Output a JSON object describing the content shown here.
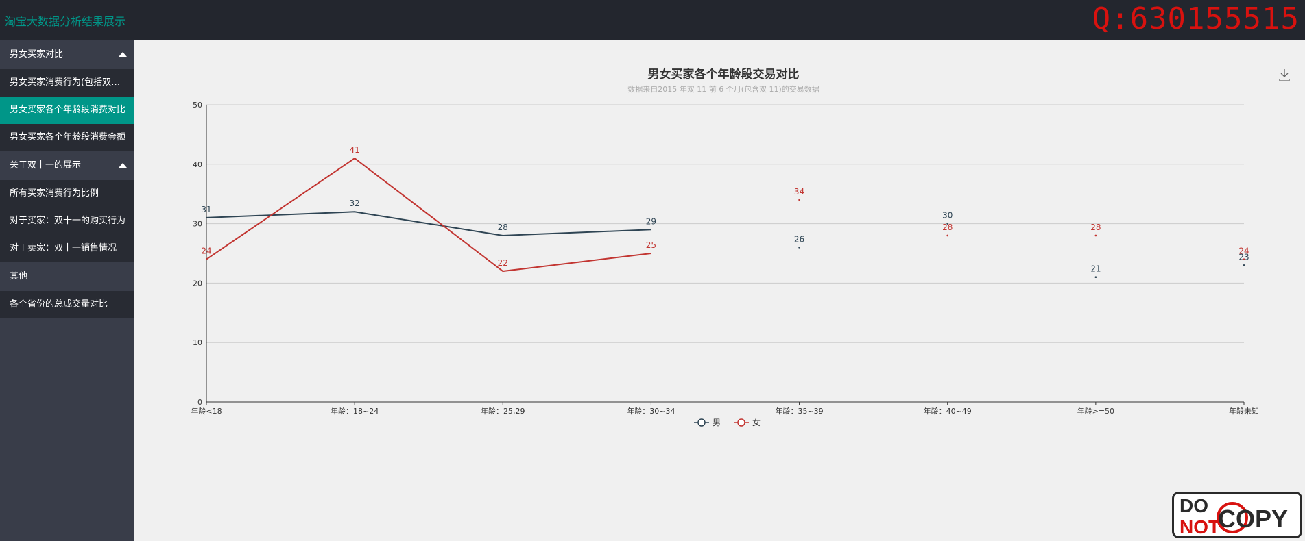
{
  "header": {
    "app_title": "淘宝大数据分析结果展示",
    "qq_label": "Q:630155515"
  },
  "colors": {
    "accent": "#009688",
    "male": "#2f4554",
    "female": "#c23531",
    "sidebar": "#393d49",
    "topbar": "#23262e"
  },
  "sidebar": {
    "groups": [
      {
        "title": "男女买家对比",
        "items": [
          {
            "label": "男女买家消费行为(包括双十一)",
            "active": false
          },
          {
            "label": "男女买家各个年龄段消费对比",
            "active": true
          },
          {
            "label": "男女买家各个年龄段消费金额",
            "active": false
          }
        ]
      },
      {
        "title": "关于双十一的展示",
        "items": [
          {
            "label": "所有买家消费行为比例",
            "active": false
          },
          {
            "label": "对于买家：双十一的购买行为",
            "active": false
          },
          {
            "label": "对于卖家：双十一销售情况",
            "active": false
          }
        ]
      },
      {
        "title": "其他",
        "items": [
          {
            "label": "各个省份的总成交量对比",
            "active": false
          }
        ]
      }
    ]
  },
  "toolbox": {
    "icon": "download-icon"
  },
  "chart_data": {
    "type": "line",
    "title": "男女买家各个年龄段交易对比",
    "subtitle": "数据来自2015 年双 11 前 6 个月(包含双 11)的交易数据",
    "categories": [
      "年龄<18",
      "年龄：18~24",
      "年龄：25,29",
      "年龄：30~34",
      "年龄：35~39",
      "年龄：40~49",
      "年龄>=50",
      "年龄未知"
    ],
    "ylim": [
      0,
      50
    ],
    "yticks": [
      "0",
      "10",
      "20",
      "30",
      "40",
      "50"
    ],
    "grid": true,
    "legend_position": "bottom-center",
    "series": [
      {
        "name": "男",
        "values": [
          31,
          32,
          28,
          29,
          26,
          30,
          21,
          23
        ],
        "labels": [
          "31",
          "32",
          "28",
          "29",
          "26",
          "30",
          "21",
          "23"
        ],
        "connected_upto": 3
      },
      {
        "name": "女",
        "values": [
          24,
          41,
          22,
          25,
          34,
          28,
          28,
          24
        ],
        "labels": [
          "24",
          "41",
          "22",
          "25",
          "34",
          "28",
          "28",
          "24"
        ],
        "connected_upto": 3
      }
    ]
  },
  "watermark": {
    "do": "DO",
    "not": "NOT",
    "copy": "COPY"
  }
}
